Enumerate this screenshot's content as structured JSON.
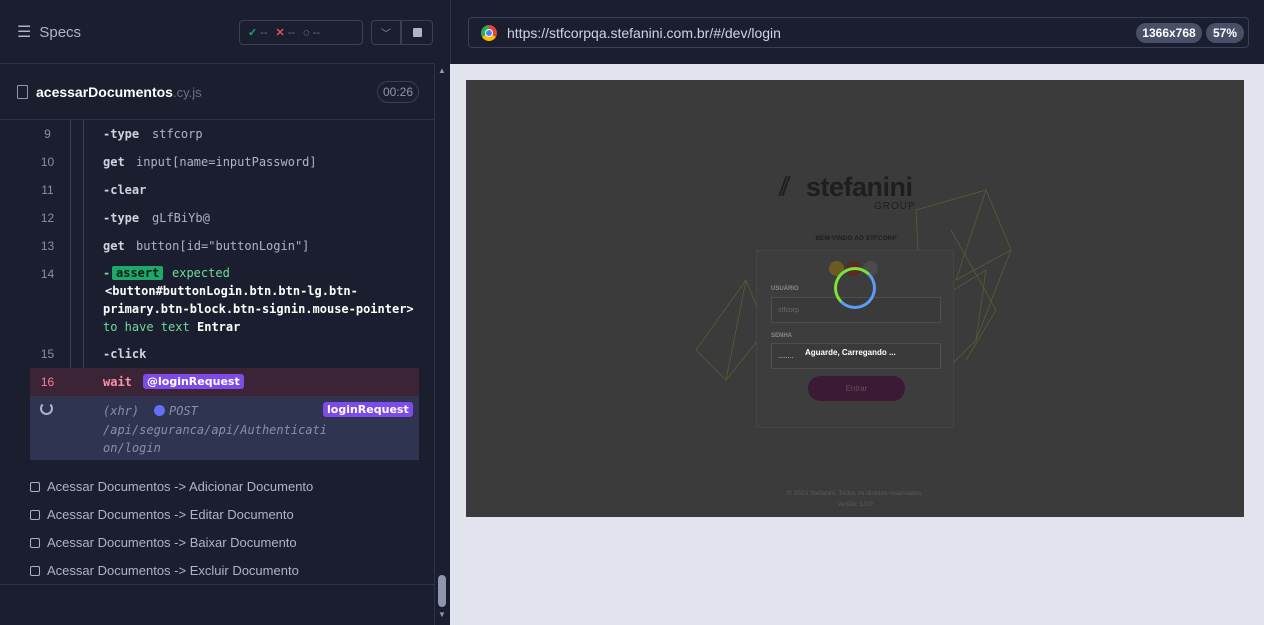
{
  "specs_panel": {
    "title": "Specs",
    "stats": {
      "passed": "--",
      "failed": "--",
      "pending": "--"
    },
    "file": {
      "name": "acessarDocumentos",
      "ext": ".cy.js",
      "duration": "00:26"
    }
  },
  "commands": [
    {
      "num": "9",
      "name": "-type",
      "message": "stfcorp"
    },
    {
      "num": "10",
      "name": "get",
      "message": "input[name=inputPassword]"
    },
    {
      "num": "11",
      "name": "-clear",
      "message": ""
    },
    {
      "num": "12",
      "name": "-type",
      "message": "gLfBiYb@"
    },
    {
      "num": "13",
      "name": "get",
      "message": "button[id=\"buttonLogin\"]"
    },
    {
      "num": "14",
      "name": "-",
      "assert_tag": "assert",
      "expected": "expected",
      "selector_line1": "<button#buttonLogin.btn.btn-lg.btn-",
      "selector_line2": "primary.btn-block.btn-signin.mouse-pointer>",
      "to_have": "to have text",
      "text": "Entrar"
    },
    {
      "num": "15",
      "name": "-click",
      "message": ""
    },
    {
      "num": "16",
      "name": "wait",
      "alias": "@loginRequest"
    }
  ],
  "xhr": {
    "type": "(xhr)",
    "method": "POST",
    "url_line1": "/api/seguranca/api/Authenticati",
    "url_line2": "on/login",
    "alias": "loginRequest"
  },
  "tests": [
    "Acessar Documentos -> Adicionar Documento",
    "Acessar Documentos -> Editar Documento",
    "Acessar Documentos -> Baixar Documento",
    "Acessar Documentos -> Excluir Documento"
  ],
  "browser": {
    "url": "https://stfcorpqa.stefanini.com.br/#/dev/login",
    "viewport": "1366x768",
    "zoom": "57%"
  },
  "app": {
    "logo": "stefanini",
    "logo_sub": "GROUP",
    "welcome": "BEM-VINDO AO STFCORP",
    "user_label": "USUÁRIO",
    "user_value": "stfcorp",
    "password_label": "SENHA",
    "password_value": "........",
    "loading_text": "Aguarde, Carregando ...",
    "submit_label": "Entrar",
    "footer": "© 2023 Stefanini. Todos os direitos reservados.",
    "version": "Versão: 1.0.0"
  },
  "colors": {
    "bg": "#1b1e2e",
    "fail": "#3a2436",
    "alias": "#7d4be8",
    "assert": "#1ea86b",
    "aut_overlay": "#3b3b3b"
  }
}
